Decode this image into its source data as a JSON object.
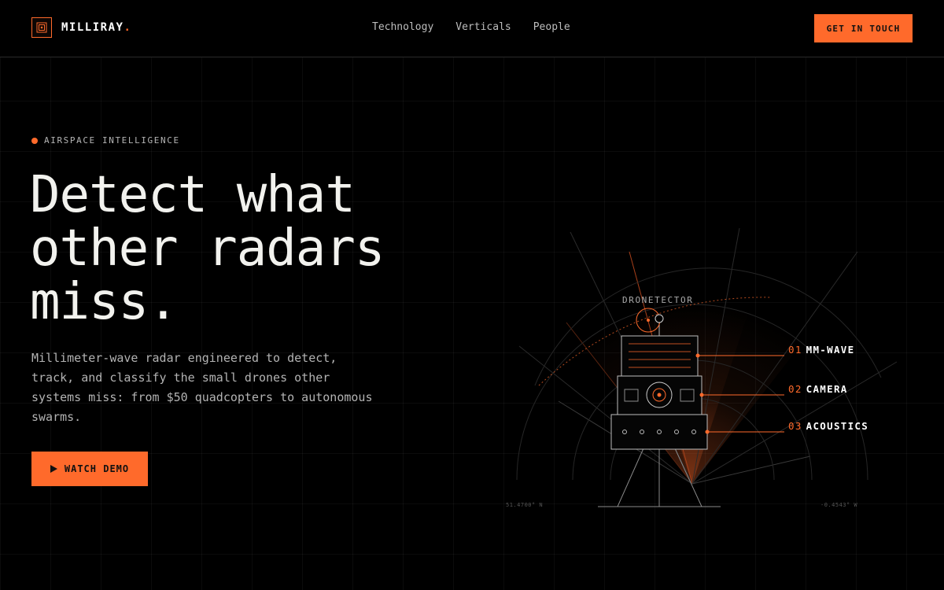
{
  "brand": {
    "name": "MILLIRAY",
    "dot": ".",
    "logo_icon": "radar-chip-icon"
  },
  "nav": {
    "links": [
      "Technology",
      "Verticals",
      "People"
    ],
    "cta_label": "GET IN TOUCH"
  },
  "hero": {
    "eyebrow": "AIRSPACE INTELLIGENCE",
    "headline": [
      "Detect what",
      "other radars",
      "miss."
    ],
    "subtext": "Millimeter-wave radar engineered to detect, track, and classify the small drones other systems miss: from $50 quadcopters to autonomous swarms.",
    "demo_label": "WATCH DEMO",
    "demo_icon": "play-icon"
  },
  "illustration": {
    "device_label": "DRONETECTOR",
    "callouts": [
      {
        "num": "01",
        "label": "MM-WAVE"
      },
      {
        "num": "02",
        "label": "CAMERA"
      },
      {
        "num": "03",
        "label": "ACOUSTICS"
      }
    ],
    "coord_left": "51.4700° N",
    "coord_right": "-0.4543° W"
  },
  "colors": {
    "accent": "#ff6a2b",
    "background": "#000000",
    "text": "#f2f2ee",
    "muted": "#b3b3b3"
  }
}
